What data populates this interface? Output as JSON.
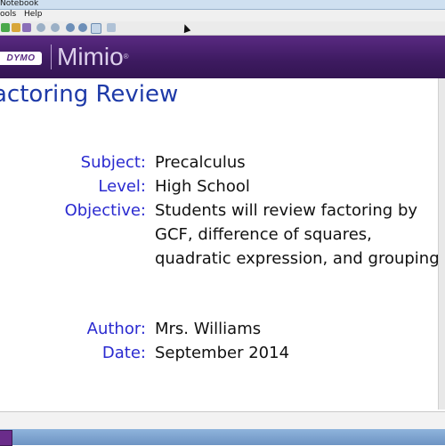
{
  "window": {
    "title": "Notebook"
  },
  "menu": [
    "ools",
    "Help"
  ],
  "banner": {
    "dymo": "DYMO",
    "brand": "Mimio",
    "tm": "®"
  },
  "lesson": {
    "title": "actoring Review",
    "fields": [
      {
        "label": "Subject:",
        "lines": [
          "Precalculus"
        ]
      },
      {
        "label": "Level:",
        "lines": [
          "High School"
        ]
      },
      {
        "label": "Objective:",
        "lines": [
          "Students will review factoring by",
          "GCF, difference of squares,",
          "quadratic expression, and grouping."
        ]
      },
      {
        "label": "Author:",
        "lines": [
          "Mrs. Williams"
        ]
      },
      {
        "label": "Date:",
        "lines": [
          "September 2014"
        ]
      }
    ]
  },
  "toolbar_icons": [
    "new-icon",
    "open-icon",
    "save-icon",
    "undo-icon",
    "redo-icon",
    "zoom-in-icon",
    "zoom-out-icon",
    "zoom-fit-icon",
    "page-icon"
  ],
  "colors": {
    "banner": "#4a1f6e",
    "title": "#1e3aa8",
    "label": "#2a2ad0"
  }
}
